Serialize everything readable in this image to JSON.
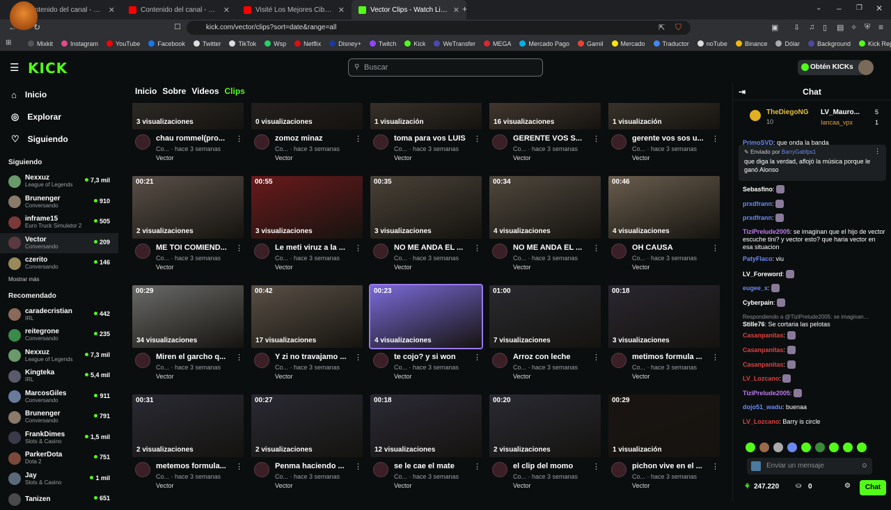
{
  "browser": {
    "tabs": [
      {
        "title": "Contenido del canal - YouTube Studio",
        "color": "#ff0000"
      },
      {
        "title": "Contenido del canal - YouTube Studio",
        "color": "#ff0000"
      },
      {
        "title": "Visité Los Mejores Cibers de Dubai -",
        "color": "#ff0000"
      },
      {
        "title": "Vector Clips - Watch Live on Kick",
        "color": "#53fc18"
      }
    ],
    "url": "kick.com/vector/clips?sort=date&range=all",
    "bookmarks": [
      "Mixkit",
      "Instagram",
      "YouTube",
      "Facebook",
      "Twitter",
      "TikTok",
      "Wsp",
      "Netflix",
      "Disney+",
      "Twitch",
      "Kick",
      "WeTransfer",
      "MEGA",
      "Mercado Pago",
      "Gamil",
      "Mercado",
      "Traductor",
      "noTube",
      "Binance",
      "Dólar",
      "Background",
      "Kick Replay"
    ]
  },
  "header": {
    "logo": "KICK",
    "search_placeholder": "Buscar",
    "cta": "Obtén KICKs"
  },
  "sidebar": {
    "nav": [
      {
        "label": "Inicio",
        "icon": "home-icon"
      },
      {
        "label": "Explorar",
        "icon": "compass-icon"
      },
      {
        "label": "Siguiendo",
        "icon": "heart-icon"
      }
    ],
    "following_title": "Siguiendo",
    "following": [
      {
        "name": "Nexxuz",
        "category": "League of Legends",
        "viewers": "7,3 mil",
        "color": "#6a9a6a"
      },
      {
        "name": "Brunenger",
        "category": "Conversando",
        "viewers": "910",
        "color": "#8a7a6a"
      },
      {
        "name": "inframe15",
        "category": "Euro Truck Simulator 2",
        "viewers": "505",
        "color": "#7a3a3a"
      },
      {
        "name": "Vector",
        "category": "Conversando",
        "viewers": "209",
        "color": "#5a3a40"
      },
      {
        "name": "czerito",
        "category": "Conversando",
        "viewers": "146",
        "color": "#9a8a5a"
      }
    ],
    "show_more": "Mostrar más",
    "recommended_title": "Recomendado",
    "recommended": [
      {
        "name": "caradecristian",
        "category": "IRL",
        "viewers": "442",
        "color": "#8a6a5a"
      },
      {
        "name": "reitegrone",
        "category": "Conversando",
        "viewers": "235",
        "color": "#3a8a4a"
      },
      {
        "name": "Nexxuz",
        "category": "League of Legends",
        "viewers": "7,3 mil",
        "color": "#6a9a6a"
      },
      {
        "name": "Kingteka",
        "category": "IRL",
        "viewers": "5,4 mil",
        "color": "#5a5a6a"
      },
      {
        "name": "MarcosGiles",
        "category": "Conversando",
        "viewers": "911",
        "color": "#6a7a9a"
      },
      {
        "name": "Brunenger",
        "category": "Conversando",
        "viewers": "791",
        "color": "#8a7a6a"
      },
      {
        "name": "FrankDimes",
        "category": "Slots & Casino",
        "viewers": "1,5 mil",
        "color": "#3a3a4a"
      },
      {
        "name": "ParkerDota",
        "category": "Dota 2",
        "viewers": "751",
        "color": "#7a4a3a"
      },
      {
        "name": "Jay",
        "category": "Slots & Casino",
        "viewers": "1 mil",
        "color": "#5a6a7a"
      },
      {
        "name": "Tanizen",
        "category": "",
        "viewers": "651",
        "color": "#4a4a4a"
      }
    ]
  },
  "channel_tabs": [
    "Inicio",
    "Sobre",
    "Videos",
    "Clips"
  ],
  "clips": [
    {
      "dur": "",
      "views": "3 visualizaciones",
      "title": "chau rommel(pro...",
      "meta": "Co... · hace 3 semanas",
      "channel": "Vector",
      "bg": "#3a3632"
    },
    {
      "dur": "",
      "views": "0 visualizaciones",
      "title": "zomoz minaz",
      "meta": "Co... · hace 3 semanas",
      "channel": "Vector",
      "bg": "#2a2624"
    },
    {
      "dur": "",
      "views": "1 visualización",
      "title": "toma para vos LUIS",
      "meta": "Co... · hace 3 semanas",
      "channel": "Vector",
      "bg": "#4a4038"
    },
    {
      "dur": "",
      "views": "16 visualizaciones",
      "title": "GERENTE VOS S...",
      "meta": "Co... · hace 3 semanas",
      "channel": "Vector",
      "bg": "#5a4a40"
    },
    {
      "dur": "",
      "views": "1 visualización",
      "title": "gerente vos sos u...",
      "meta": "Co... · hace 3 semanas",
      "channel": "Vector",
      "bg": "#4a4438"
    },
    {
      "dur": "00:21",
      "views": "2 visualizaciones",
      "title": "ME TOI COMIEND...",
      "meta": "Co... · hace 3 semanas",
      "channel": "Vector",
      "bg": "#5a5048"
    },
    {
      "dur": "00:55",
      "views": "3 visualizaciones",
      "title": "Le meti viruz a la ...",
      "meta": "Co... · hace 3 semanas",
      "channel": "Vector",
      "bg": "#6a1a1c"
    },
    {
      "dur": "00:35",
      "views": "3 visualizaciones",
      "title": "NO ME ANDA EL ...",
      "meta": "Co... · hace 3 semanas",
      "channel": "Vector",
      "bg": "#4a4238"
    },
    {
      "dur": "00:34",
      "views": "4 visualizaciones",
      "title": "NO ME ANDA EL ...",
      "meta": "Co... · hace 3 semanas",
      "channel": "Vector",
      "bg": "#50483e"
    },
    {
      "dur": "00:46",
      "views": "4 visualizaciones",
      "title": "OH CAUSA",
      "meta": "Co... · hace 3 semanas",
      "channel": "Vector",
      "bg": "#6a5e4e"
    },
    {
      "dur": "00:29",
      "views": "34 visualizaciones",
      "title": "Miren el garcho q...",
      "meta": "Co... · hace 3 semanas",
      "channel": "Vector",
      "bg": "#6a6a68"
    },
    {
      "dur": "00:42",
      "views": "17 visualizaciones",
      "title": "Y zi no travajamo ...",
      "meta": "Co... · hace 3 semanas",
      "channel": "Vector",
      "bg": "#5a5046"
    },
    {
      "dur": "00:23",
      "views": "4 visualizaciones",
      "title": "te cojo? y si won",
      "meta": "Co... · hace 3 semanas",
      "channel": "Vector",
      "bg": "#7a6ad8"
    },
    {
      "dur": "01:00",
      "views": "7 visualizaciones",
      "title": "Arroz con leche",
      "meta": "Co... · hace 3 semanas",
      "channel": "Vector",
      "bg": "#2a2a30"
    },
    {
      "dur": "00:18",
      "views": "3 visualizaciones",
      "title": "metimos formula ...",
      "meta": "Co... · hace 3 semanas",
      "channel": "Vector",
      "bg": "#2a2630"
    },
    {
      "dur": "00:31",
      "views": "2 visualizaciones",
      "title": "metemos formula...",
      "meta": "Co... · hace 3 semanas",
      "channel": "Vector",
      "bg": "#2a2a34"
    },
    {
      "dur": "00:27",
      "views": "2 visualizaciones",
      "title": "Penma haciendo ...",
      "meta": "Co... · hace 3 semanas",
      "channel": "Vector",
      "bg": "#2a2a34"
    },
    {
      "dur": "00:18",
      "views": "12 visualizaciones",
      "title": "se le cae el mate",
      "meta": "Co... · hace 3 semanas",
      "channel": "Vector",
      "bg": "#2c2a36"
    },
    {
      "dur": "00:20",
      "views": "2 visualizaciones",
      "title": "el clip del momo",
      "meta": "Co... · hace 3 semanas",
      "channel": "Vector",
      "bg": "#2a2a34"
    },
    {
      "dur": "00:29",
      "views": "1 visualización",
      "title": "pichon vive en el ...",
      "meta": "Co... · hace 3 semanas",
      "channel": "Vector",
      "bg": "#1a1412"
    }
  ],
  "chat": {
    "title": "Chat",
    "top": [
      {
        "name": "TheDiegoNG",
        "count": "10"
      },
      {
        "name": "LV_Mauro...",
        "count": "5"
      },
      {
        "name": "Iancaa_vpx",
        "count": "1"
      }
    ],
    "pinned": {
      "by_label": "Enviado por",
      "by": "BarryGabfps1",
      "text": "que diga la verdad, aflojó la música porque le ganó Alonso"
    },
    "messages": [
      {
        "user": "PrimoSVD",
        "text": "que onda la banda",
        "color": "#6a8af0"
      },
      {
        "user": "Sebasfino",
        "text": "",
        "color": "#ffffff",
        "emote": true
      },
      {
        "user": "prxdfrann",
        "text": "",
        "color": "#6a8af0",
        "emote": true
      },
      {
        "user": "prxdfrann",
        "text": "",
        "color": "#6a8af0",
        "emote": true
      },
      {
        "user": "TiziPrelude2005",
        "text": "se imaginan que el hijo de vector escuche tini? y vector esto? que haria vector en esa situacion",
        "color": "#c07af0"
      },
      {
        "user": "PatyFlaco",
        "text": "viu",
        "color": "#6a8af0"
      },
      {
        "user": "LV_Foreword",
        "text": "",
        "color": "#ffffff",
        "emote": true
      },
      {
        "user": "eugee_x",
        "text": "",
        "color": "#6a8af0",
        "emote": true
      },
      {
        "user": "Cyberpain",
        "text": "",
        "color": "#ffffff",
        "emote": true
      },
      {
        "user": "Stille76",
        "text": "Se cortaria las pelotas",
        "color": "#ffffff",
        "reply": "Respondiendo a @TiziPrelude2005: se imaginan..."
      },
      {
        "user": "Casanpanitas",
        "text": "",
        "color": "#e04040",
        "emote": true
      },
      {
        "user": "Casanpanitas",
        "text": "",
        "color": "#e04040",
        "emote": true
      },
      {
        "user": "Casanpanitas",
        "text": "",
        "color": "#e04040",
        "emote": true
      },
      {
        "user": "LV_Lozcano",
        "text": "",
        "color": "#e04040",
        "emote": true
      },
      {
        "user": "TiziPrelude2005",
        "text": "",
        "color": "#c07af0",
        "emote": true
      },
      {
        "user": "dojo51_wadu",
        "text": "buenaa",
        "color": "#6a8af0"
      },
      {
        "user": "LV_Lozcano",
        "text": "Barry is circle",
        "color": "#e04040"
      }
    ],
    "input_placeholder": "Enviar un mensaje",
    "points": "247.220",
    "gifts": "0",
    "send": "Chat"
  }
}
